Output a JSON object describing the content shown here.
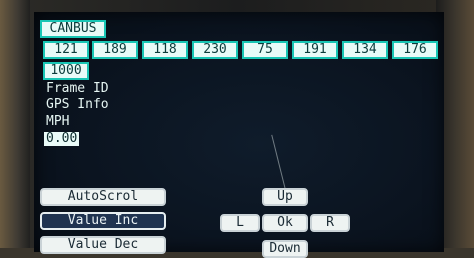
{
  "header": {
    "title": "CANBUS"
  },
  "bytes": [
    "121",
    "189",
    "118",
    "230",
    "75",
    "191",
    "134",
    "176"
  ],
  "frame_id_value": "1000",
  "labels": {
    "frame_id": "Frame ID",
    "gps_info": "GPS Info",
    "mph": "MPH"
  },
  "speed_value": "0.00",
  "buttons": {
    "autoscroll": "AutoScrol",
    "value_inc": "Value Inc",
    "value_dec": "Value Dec",
    "up": "Up",
    "left": "L",
    "ok": "Ok",
    "right": "R",
    "down": "Down"
  },
  "colors": {
    "accent": "#19c6b5",
    "screen_bg": "#0b1420",
    "button_bg": "#eef3f2",
    "active_button_bg": "#1f3350"
  }
}
